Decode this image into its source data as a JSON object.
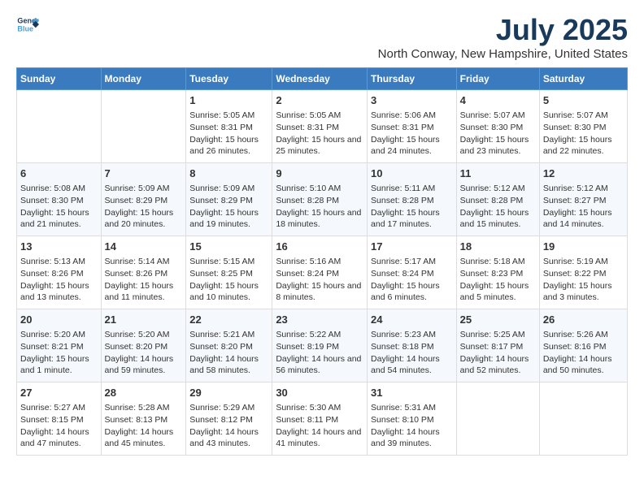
{
  "logo": {
    "line1": "General",
    "line2": "Blue"
  },
  "title": "July 2025",
  "location": "North Conway, New Hampshire, United States",
  "weekdays": [
    "Sunday",
    "Monday",
    "Tuesday",
    "Wednesday",
    "Thursday",
    "Friday",
    "Saturday"
  ],
  "weeks": [
    [
      {
        "day": "",
        "sunrise": "",
        "sunset": "",
        "daylight": ""
      },
      {
        "day": "",
        "sunrise": "",
        "sunset": "",
        "daylight": ""
      },
      {
        "day": "1",
        "sunrise": "Sunrise: 5:05 AM",
        "sunset": "Sunset: 8:31 PM",
        "daylight": "Daylight: 15 hours and 26 minutes."
      },
      {
        "day": "2",
        "sunrise": "Sunrise: 5:05 AM",
        "sunset": "Sunset: 8:31 PM",
        "daylight": "Daylight: 15 hours and 25 minutes."
      },
      {
        "day": "3",
        "sunrise": "Sunrise: 5:06 AM",
        "sunset": "Sunset: 8:31 PM",
        "daylight": "Daylight: 15 hours and 24 minutes."
      },
      {
        "day": "4",
        "sunrise": "Sunrise: 5:07 AM",
        "sunset": "Sunset: 8:30 PM",
        "daylight": "Daylight: 15 hours and 23 minutes."
      },
      {
        "day": "5",
        "sunrise": "Sunrise: 5:07 AM",
        "sunset": "Sunset: 8:30 PM",
        "daylight": "Daylight: 15 hours and 22 minutes."
      }
    ],
    [
      {
        "day": "6",
        "sunrise": "Sunrise: 5:08 AM",
        "sunset": "Sunset: 8:30 PM",
        "daylight": "Daylight: 15 hours and 21 minutes."
      },
      {
        "day": "7",
        "sunrise": "Sunrise: 5:09 AM",
        "sunset": "Sunset: 8:29 PM",
        "daylight": "Daylight: 15 hours and 20 minutes."
      },
      {
        "day": "8",
        "sunrise": "Sunrise: 5:09 AM",
        "sunset": "Sunset: 8:29 PM",
        "daylight": "Daylight: 15 hours and 19 minutes."
      },
      {
        "day": "9",
        "sunrise": "Sunrise: 5:10 AM",
        "sunset": "Sunset: 8:28 PM",
        "daylight": "Daylight: 15 hours and 18 minutes."
      },
      {
        "day": "10",
        "sunrise": "Sunrise: 5:11 AM",
        "sunset": "Sunset: 8:28 PM",
        "daylight": "Daylight: 15 hours and 17 minutes."
      },
      {
        "day": "11",
        "sunrise": "Sunrise: 5:12 AM",
        "sunset": "Sunset: 8:28 PM",
        "daylight": "Daylight: 15 hours and 15 minutes."
      },
      {
        "day": "12",
        "sunrise": "Sunrise: 5:12 AM",
        "sunset": "Sunset: 8:27 PM",
        "daylight": "Daylight: 15 hours and 14 minutes."
      }
    ],
    [
      {
        "day": "13",
        "sunrise": "Sunrise: 5:13 AM",
        "sunset": "Sunset: 8:26 PM",
        "daylight": "Daylight: 15 hours and 13 minutes."
      },
      {
        "day": "14",
        "sunrise": "Sunrise: 5:14 AM",
        "sunset": "Sunset: 8:26 PM",
        "daylight": "Daylight: 15 hours and 11 minutes."
      },
      {
        "day": "15",
        "sunrise": "Sunrise: 5:15 AM",
        "sunset": "Sunset: 8:25 PM",
        "daylight": "Daylight: 15 hours and 10 minutes."
      },
      {
        "day": "16",
        "sunrise": "Sunrise: 5:16 AM",
        "sunset": "Sunset: 8:24 PM",
        "daylight": "Daylight: 15 hours and 8 minutes."
      },
      {
        "day": "17",
        "sunrise": "Sunrise: 5:17 AM",
        "sunset": "Sunset: 8:24 PM",
        "daylight": "Daylight: 15 hours and 6 minutes."
      },
      {
        "day": "18",
        "sunrise": "Sunrise: 5:18 AM",
        "sunset": "Sunset: 8:23 PM",
        "daylight": "Daylight: 15 hours and 5 minutes."
      },
      {
        "day": "19",
        "sunrise": "Sunrise: 5:19 AM",
        "sunset": "Sunset: 8:22 PM",
        "daylight": "Daylight: 15 hours and 3 minutes."
      }
    ],
    [
      {
        "day": "20",
        "sunrise": "Sunrise: 5:20 AM",
        "sunset": "Sunset: 8:21 PM",
        "daylight": "Daylight: 15 hours and 1 minute."
      },
      {
        "day": "21",
        "sunrise": "Sunrise: 5:20 AM",
        "sunset": "Sunset: 8:20 PM",
        "daylight": "Daylight: 14 hours and 59 minutes."
      },
      {
        "day": "22",
        "sunrise": "Sunrise: 5:21 AM",
        "sunset": "Sunset: 8:20 PM",
        "daylight": "Daylight: 14 hours and 58 minutes."
      },
      {
        "day": "23",
        "sunrise": "Sunrise: 5:22 AM",
        "sunset": "Sunset: 8:19 PM",
        "daylight": "Daylight: 14 hours and 56 minutes."
      },
      {
        "day": "24",
        "sunrise": "Sunrise: 5:23 AM",
        "sunset": "Sunset: 8:18 PM",
        "daylight": "Daylight: 14 hours and 54 minutes."
      },
      {
        "day": "25",
        "sunrise": "Sunrise: 5:25 AM",
        "sunset": "Sunset: 8:17 PM",
        "daylight": "Daylight: 14 hours and 52 minutes."
      },
      {
        "day": "26",
        "sunrise": "Sunrise: 5:26 AM",
        "sunset": "Sunset: 8:16 PM",
        "daylight": "Daylight: 14 hours and 50 minutes."
      }
    ],
    [
      {
        "day": "27",
        "sunrise": "Sunrise: 5:27 AM",
        "sunset": "Sunset: 8:15 PM",
        "daylight": "Daylight: 14 hours and 47 minutes."
      },
      {
        "day": "28",
        "sunrise": "Sunrise: 5:28 AM",
        "sunset": "Sunset: 8:13 PM",
        "daylight": "Daylight: 14 hours and 45 minutes."
      },
      {
        "day": "29",
        "sunrise": "Sunrise: 5:29 AM",
        "sunset": "Sunset: 8:12 PM",
        "daylight": "Daylight: 14 hours and 43 minutes."
      },
      {
        "day": "30",
        "sunrise": "Sunrise: 5:30 AM",
        "sunset": "Sunset: 8:11 PM",
        "daylight": "Daylight: 14 hours and 41 minutes."
      },
      {
        "day": "31",
        "sunrise": "Sunrise: 5:31 AM",
        "sunset": "Sunset: 8:10 PM",
        "daylight": "Daylight: 14 hours and 39 minutes."
      },
      {
        "day": "",
        "sunrise": "",
        "sunset": "",
        "daylight": ""
      },
      {
        "day": "",
        "sunrise": "",
        "sunset": "",
        "daylight": ""
      }
    ]
  ]
}
